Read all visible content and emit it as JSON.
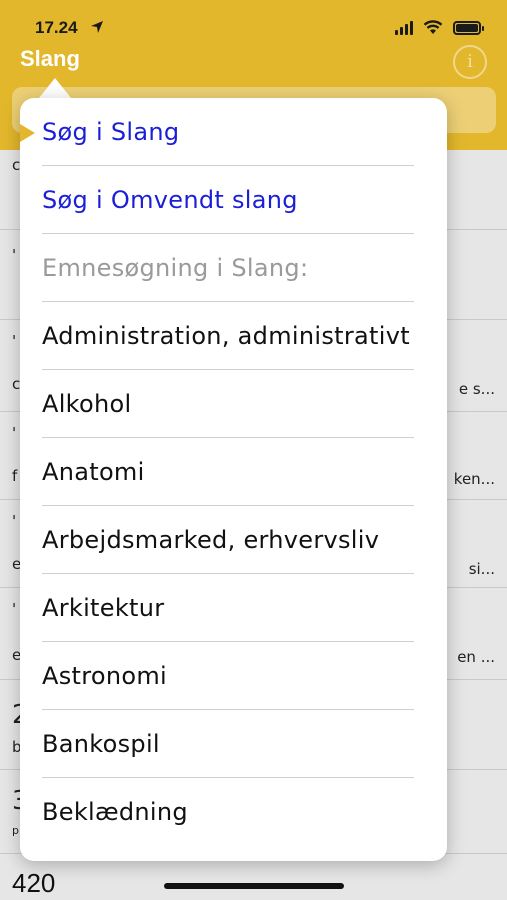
{
  "status_bar": {
    "time": "17.24"
  },
  "nav": {
    "title": "Slang",
    "info_glyph": "i"
  },
  "background": {
    "snippets": [
      "e s...",
      "ken...",
      "si...",
      "en ..."
    ],
    "left_fragments": [
      "c",
      "'",
      "'",
      "c",
      "'",
      "f",
      "'",
      "e",
      "'",
      "e",
      "2",
      "b",
      "3",
      "p"
    ],
    "bottom_number": "420"
  },
  "popover": {
    "items": [
      {
        "label": "Søg i Slang",
        "kind": "link"
      },
      {
        "label": "Søg i Omvendt slang",
        "kind": "link"
      },
      {
        "label": "Emnesøgning i Slang:",
        "kind": "header"
      },
      {
        "label": "Administration, administrativt",
        "kind": "topic"
      },
      {
        "label": "Alkohol",
        "kind": "topic"
      },
      {
        "label": "Anatomi",
        "kind": "topic"
      },
      {
        "label": "Arbejdsmarked, erhvervsliv",
        "kind": "topic"
      },
      {
        "label": "Arkitektur",
        "kind": "topic"
      },
      {
        "label": "Astronomi",
        "kind": "topic"
      },
      {
        "label": "Bankospil",
        "kind": "topic"
      },
      {
        "label": "Beklædning",
        "kind": "topic"
      }
    ]
  },
  "colors": {
    "accent": "#e3b72c",
    "link": "#1b1fd6",
    "header": "#9a9a9a"
  }
}
